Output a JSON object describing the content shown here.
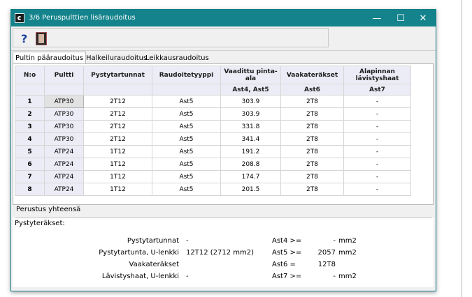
{
  "window": {
    "title": "3/6  Peruspulttien lisäraudoitus",
    "minimize": "—",
    "maximize": "☐",
    "close": "✕"
  },
  "toolbar": {
    "help_label": "?"
  },
  "tabs": [
    "Pultin pääraudoitus",
    "Halkeiluraudoitus",
    "Leikkausraudoitus"
  ],
  "table": {
    "headers": [
      "N:o",
      "Pultti",
      "Pystytartunnat",
      "Raudoitetyyppi",
      "Vaadittu pinta-ala",
      "Vaakateräkset",
      "Alapinnan lävistyshaat"
    ],
    "subheaders": [
      "",
      "",
      "",
      "",
      "Ast4, Ast5",
      "Ast6",
      "Ast7"
    ],
    "rows": [
      [
        "1",
        "ATP30",
        "2T12",
        "Ast5",
        "303.9",
        "2T8",
        "-"
      ],
      [
        "2",
        "ATP30",
        "2T12",
        "Ast5",
        "303.9",
        "2T8",
        "-"
      ],
      [
        "3",
        "ATP30",
        "2T12",
        "Ast5",
        "331.8",
        "2T8",
        "-"
      ],
      [
        "4",
        "ATP30",
        "2T12",
        "Ast5",
        "341.4",
        "2T8",
        "-"
      ],
      [
        "5",
        "ATP24",
        "1T12",
        "Ast5",
        "191.2",
        "2T8",
        "-"
      ],
      [
        "6",
        "ATP24",
        "1T12",
        "Ast5",
        "208.8",
        "2T8",
        "-"
      ],
      [
        "7",
        "ATP24",
        "1T12",
        "Ast5",
        "174.7",
        "2T8",
        "-"
      ],
      [
        "8",
        "ATP24",
        "1T12",
        "Ast5",
        "201.5",
        "2T8",
        "-"
      ]
    ]
  },
  "summary": {
    "group_title": "Perustus yhteensä",
    "section_label": "Pystyteräkset:",
    "rows": [
      {
        "label": "Pystytartunnat",
        "value": "-",
        "ast": "Ast4 >=",
        "num": "-",
        "unit": "mm2"
      },
      {
        "label": "Pystytartunta, U-lenkki",
        "value": "12T12 (2712 mm2)",
        "ast": "Ast5 >=",
        "num": "2057",
        "unit": "mm2"
      },
      {
        "label": "Vaakateräkset",
        "value": "",
        "ast": "Ast6  =",
        "num": "12T8",
        "unit": ""
      },
      {
        "label": "Lävistyshaat, U-lenkki",
        "value": "-",
        "ast": "Ast7 >=",
        "num": "-",
        "unit": "mm2"
      }
    ]
  }
}
